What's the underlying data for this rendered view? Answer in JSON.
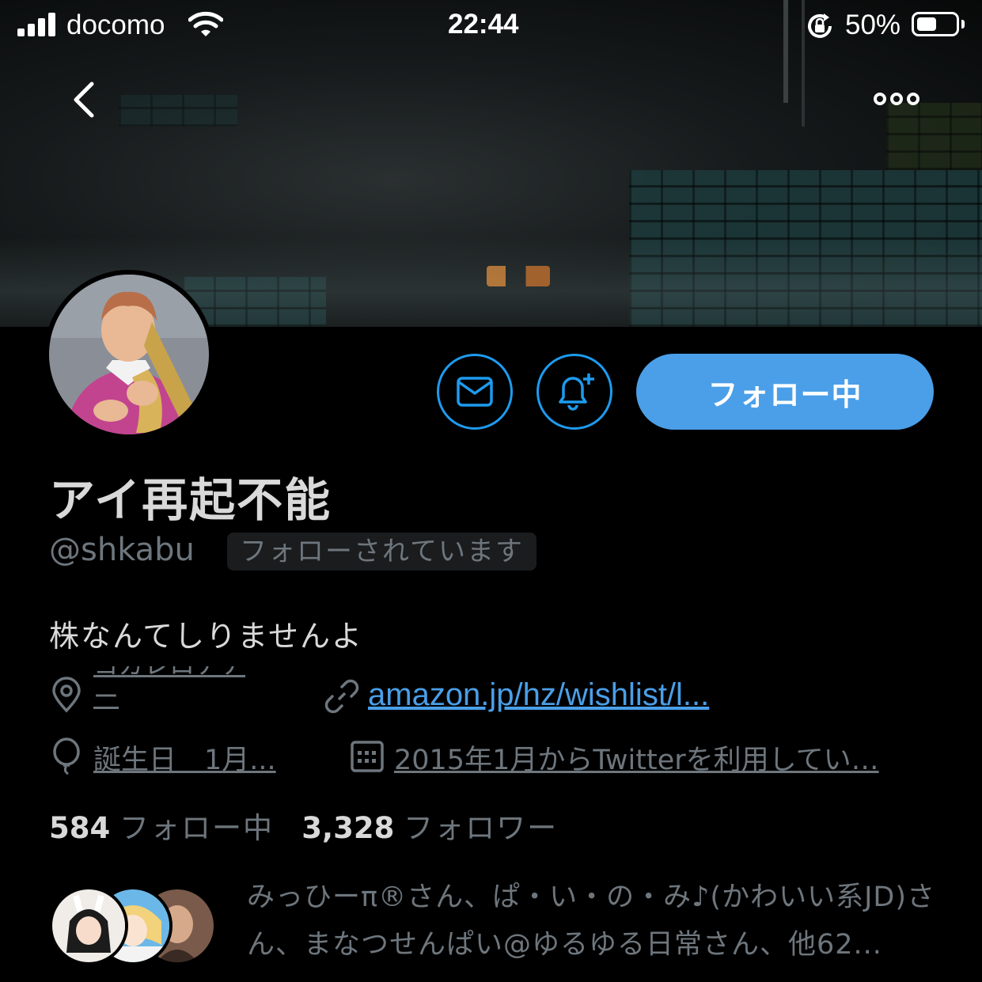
{
  "status_bar": {
    "carrier": "docomo",
    "time": "22:44",
    "battery_percent": "50%"
  },
  "nav": {
    "back_icon": "chevron-left-icon",
    "more_icon": "more-horizontal-icon"
  },
  "profile": {
    "display_name": "アイ再起不能",
    "username": "@shkabu",
    "follows_you_badge": "フォローされています",
    "bio": "株なんてしりませんよ",
    "location": "ヨガレロナナー",
    "website": "amazon.jp/hz/wishlist/l...",
    "birthday": "誕生日　1月...",
    "joined": "2015年1月からTwitterを利用してい…"
  },
  "actions": {
    "following_label": "フォロー中"
  },
  "stats": {
    "following_count": "584",
    "following_label": "フォロー中",
    "followers_count": "3,328",
    "followers_label": "フォロワー"
  },
  "mutuals": {
    "text": "みっひーπ®さん、ぱ・い・の・み♪(かわいい系JD)さん、まなつせんぱい@ゆるゆる日常さん、他62..."
  },
  "colors": {
    "accent": "#4a9fe8",
    "background": "#000000",
    "secondary_text": "#6e767d"
  }
}
